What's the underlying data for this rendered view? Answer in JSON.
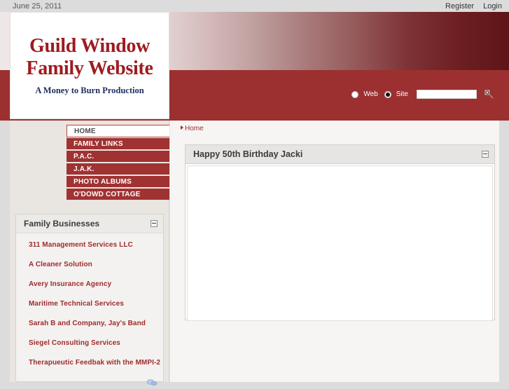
{
  "topbar": {
    "date": "June 25, 2011",
    "register_label": "Register",
    "login_label": "Login"
  },
  "logo": {
    "line1": "Guild Window",
    "line2": "Family Website",
    "tagline": "A Money to Burn Production",
    "color": "#9e1b20",
    "tagline_color": "#1d2d5e"
  },
  "search": {
    "scope_web_label": "Web",
    "scope_site_label": "Site",
    "selected_scope": "Site",
    "value": "",
    "placeholder": "",
    "go_icon": "search-icon",
    "band_color": "#9c3030"
  },
  "nav": {
    "items": [
      {
        "label": "HOME",
        "active": true
      },
      {
        "label": "FAMILY LINKS",
        "active": false
      },
      {
        "label": "P.A.C.",
        "active": false
      },
      {
        "label": "J.A.K.",
        "active": false
      },
      {
        "label": "PHOTO ALBUMS",
        "active": false
      },
      {
        "label": "O'DOWD COTTAGE",
        "active": false
      }
    ]
  },
  "family_businesses": {
    "title": "Family Businesses",
    "collapse_icon": "minus-icon",
    "feed_icon": "feed-icon",
    "links": [
      "311 Management Services LLC",
      "A Cleaner Solution",
      "Avery Insurance Agency",
      "Maritime Technical Services",
      "Sarah B and Company, Jay's Band",
      "Siegel Consulting Services",
      "Therapueutic Feedbak with the MMPI-2"
    ]
  },
  "breadcrumb": {
    "home_label": "Home"
  },
  "content_panel": {
    "title": "Happy 50th Birthday Jacki",
    "collapse_icon": "minus-icon",
    "body_text": ""
  }
}
